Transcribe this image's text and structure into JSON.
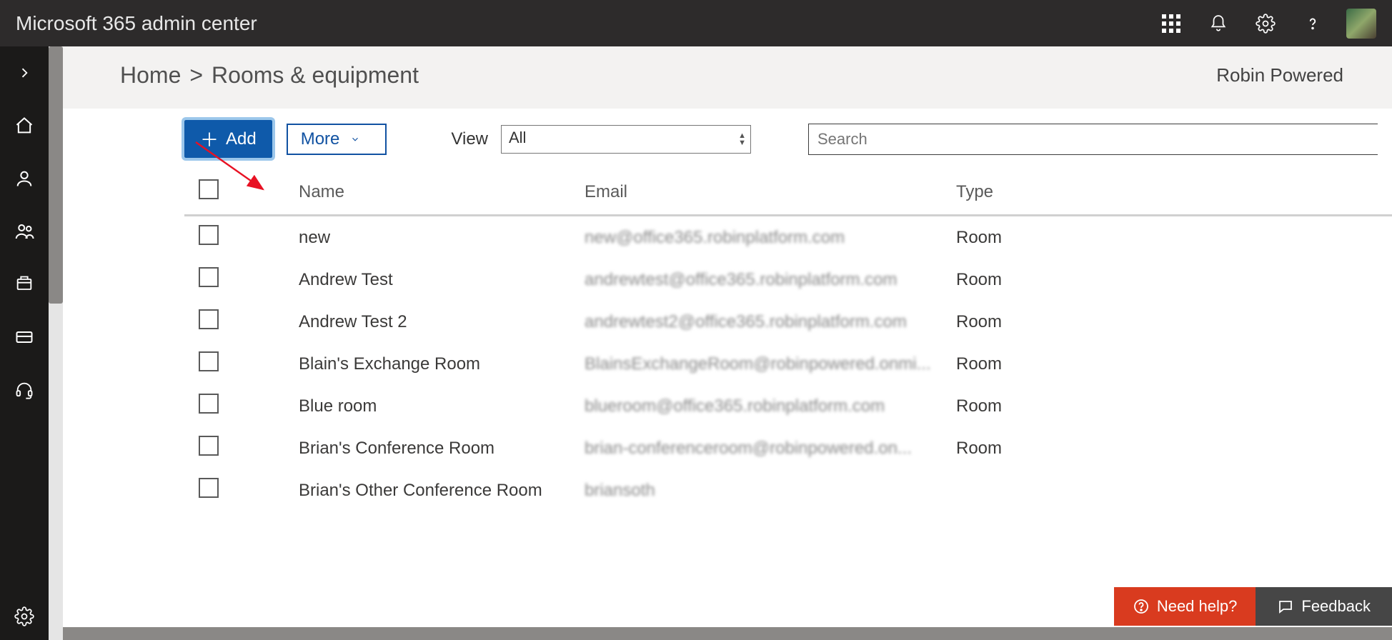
{
  "header": {
    "title": "Microsoft 365 admin center"
  },
  "breadcrumb": {
    "home": "Home",
    "separator": ">",
    "current": "Rooms & equipment",
    "tenant": "Robin Powered"
  },
  "toolbar": {
    "add_label": "Add",
    "more_label": "More",
    "view_label": "View",
    "view_value": "All",
    "search_placeholder": "Search"
  },
  "table": {
    "columns": {
      "name": "Name",
      "email": "Email",
      "type": "Type"
    },
    "rows": [
      {
        "name": "new",
        "email": "new@office365.robinplatform.com",
        "type": "Room"
      },
      {
        "name": "Andrew Test",
        "email": "andrewtest@office365.robinplatform.com",
        "type": "Room"
      },
      {
        "name": "Andrew Test 2",
        "email": "andrewtest2@office365.robinplatform.com",
        "type": "Room"
      },
      {
        "name": "Blain's Exchange Room",
        "email": "BlainsExchangeRoom@robinpowered.onmi...",
        "type": "Room"
      },
      {
        "name": "Blue room",
        "email": "blueroom@office365.robinplatform.com",
        "type": "Room"
      },
      {
        "name": "Brian's Conference Room",
        "email": "brian-conferenceroom@robinpowered.on...",
        "type": "Room"
      },
      {
        "name": "Brian's Other Conference Room",
        "email": "briansoth",
        "type": ""
      }
    ]
  },
  "footer": {
    "need_help": "Need help?",
    "feedback": "Feedback"
  }
}
